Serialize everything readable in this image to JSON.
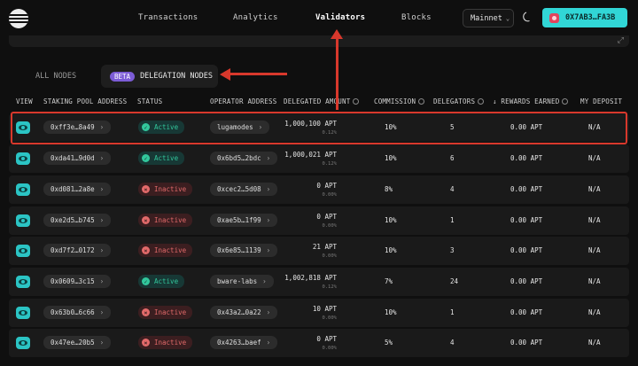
{
  "nav": {
    "transactions": "Transactions",
    "analytics": "Analytics",
    "validators": "Validators",
    "blocks": "Blocks",
    "network": "Mainnet",
    "wallet": "0X7AB3…FA3B"
  },
  "tabs": {
    "all_nodes": "ALL NODES",
    "beta_badge": "BETA",
    "delegation_nodes": "DELEGATION NODES"
  },
  "columns": {
    "view": "VIEW",
    "pool": "STAKING POOL ADDRESS",
    "status": "STATUS",
    "operator": "OPERATOR ADDRESS",
    "delegated": "DELEGATED AMOUNT",
    "commission": "COMMISSION",
    "delegators": "DELEGATORS",
    "rewards": "↓ REWARDS EARNED",
    "deposit": "MY DEPOSIT"
  },
  "rows": [
    {
      "pool": "0xff3e…8a49",
      "status": "Active",
      "operator": "lugamodes",
      "amount": "1,000,100 APT",
      "pct": "0.12%",
      "commission": "10%",
      "delegators": "5",
      "rewards": "0.00 APT",
      "deposit": "N/A"
    },
    {
      "pool": "0xda41…9d0d",
      "status": "Active",
      "operator": "0x6bd5…2bdc",
      "amount": "1,000,021 APT",
      "pct": "0.12%",
      "commission": "10%",
      "delegators": "6",
      "rewards": "0.00 APT",
      "deposit": "N/A"
    },
    {
      "pool": "0xd081…2a8e",
      "status": "Inactive",
      "operator": "0xcec2…5d08",
      "amount": "0 APT",
      "pct": "0.00%",
      "commission": "8%",
      "delegators": "4",
      "rewards": "0.00 APT",
      "deposit": "N/A"
    },
    {
      "pool": "0xe2d5…b745",
      "status": "Inactive",
      "operator": "0xae5b…1f99",
      "amount": "0 APT",
      "pct": "0.00%",
      "commission": "10%",
      "delegators": "1",
      "rewards": "0.00 APT",
      "deposit": "N/A"
    },
    {
      "pool": "0xd7f2…0172",
      "status": "Inactive",
      "operator": "0x6e85…1139",
      "amount": "21 APT",
      "pct": "0.00%",
      "commission": "10%",
      "delegators": "3",
      "rewards": "0.00 APT",
      "deposit": "N/A"
    },
    {
      "pool": "0x0609…3c15",
      "status": "Active",
      "operator": "bware-labs",
      "amount": "1,002,818 APT",
      "pct": "0.12%",
      "commission": "7%",
      "delegators": "24",
      "rewards": "0.00 APT",
      "deposit": "N/A"
    },
    {
      "pool": "0x63b0…6c66",
      "status": "Inactive",
      "operator": "0x43a2…0a22",
      "amount": "10 APT",
      "pct": "0.00%",
      "commission": "10%",
      "delegators": "1",
      "rewards": "0.00 APT",
      "deposit": "N/A"
    },
    {
      "pool": "0x47ee…20b5",
      "status": "Inactive",
      "operator": "0x4263…baef",
      "amount": "0 APT",
      "pct": "0.00%",
      "commission": "5%",
      "delegators": "4",
      "rewards": "0.00 APT",
      "deposit": "N/A"
    }
  ],
  "colors": {
    "accent": "#31d6d6",
    "active": "#32c79c",
    "inactive": "#e26a6a",
    "annotation": "#d8382c",
    "beta": "#7c5cd6"
  }
}
